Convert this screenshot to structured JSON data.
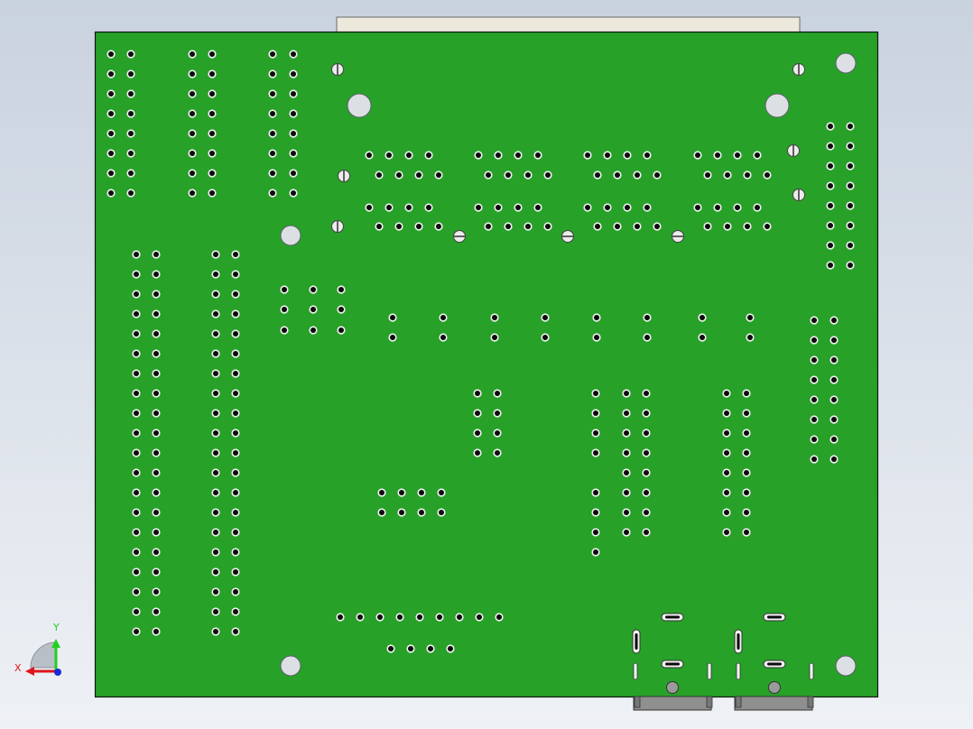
{
  "view": {
    "background_colors": [
      "#c9d2df",
      "#eef1f5"
    ]
  },
  "board": {
    "pcb_color": "#27a128",
    "edge_color": "#101810",
    "connector_color": "#ece9dc",
    "pad_color": "#f2f2f2",
    "drill_color": "#0b0b0b",
    "mount_hole_color": "#dcdfe3",
    "screw_color": "#ececec"
  },
  "triad": {
    "x_label": "X",
    "y_label": "Y",
    "x_color": "#e0141b",
    "y_color": "#1fd11f",
    "z_color": "#1a2bd6"
  }
}
